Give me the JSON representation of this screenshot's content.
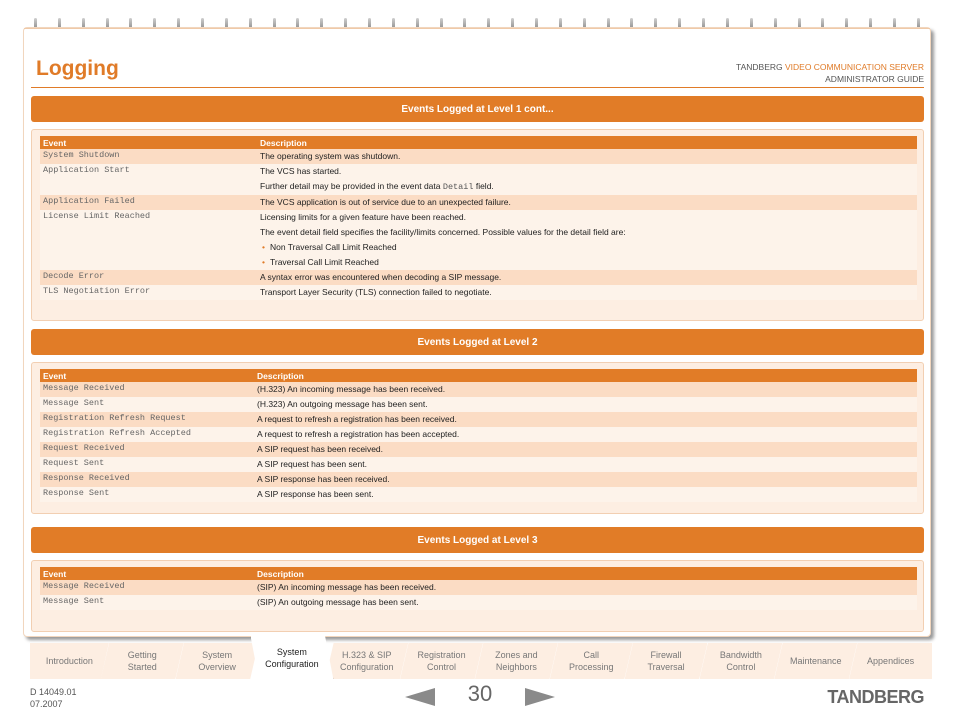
{
  "header": {
    "title": "Logging",
    "guide_prefix": "TANDBERG ",
    "guide_product": "VIDEO COMMUNICATION SERVER",
    "guide_type": "ADMINISTRATOR GUIDE"
  },
  "colors": {
    "accent": "#e17c27",
    "row_shade": "#fbdcc4",
    "box_bg": "#fdeee2"
  },
  "table_headers": {
    "event": "Event",
    "description": "Description"
  },
  "sections": [
    {
      "title": "Events Logged at Level 1 cont...",
      "rows": [
        {
          "event": "System Shutdown",
          "description": [
            "The operating system was shutdown."
          ]
        },
        {
          "event": "Application Start",
          "description": [
            "The VCS has started."
          ],
          "detail_pre": "Further detail may be provided in the event data ",
          "detail_code": "Detail",
          "detail_post": " field."
        },
        {
          "event": "Application Failed",
          "description": [
            "The VCS application is out of service due to an unexpected failure."
          ]
        },
        {
          "event": "License Limit Reached",
          "description": [
            "Licensing limits for a given feature have been reached.",
            "The event detail field specifies the facility/limits concerned. Possible values for the detail field are:"
          ],
          "bullets": [
            "Non Traversal Call Limit Reached",
            "Traversal Call Limit Reached"
          ]
        },
        {
          "event": "Decode Error",
          "description": [
            "A syntax error was encountered when decoding a SIP message."
          ]
        },
        {
          "event": "TLS Negotiation Error",
          "description": [
            "Transport Layer Security (TLS) connection failed to negotiate."
          ]
        }
      ]
    },
    {
      "title": "Events Logged at Level 2",
      "rows": [
        {
          "event": "Message Received",
          "description": [
            "(H.323) An incoming message has been received."
          ]
        },
        {
          "event": "Message Sent",
          "description": [
            "(H.323) An outgoing message has been sent."
          ]
        },
        {
          "event": "Registration Refresh Request",
          "description": [
            "A request to refresh a registration has been received."
          ]
        },
        {
          "event": "Registration Refresh Accepted",
          "description": [
            "A request to refresh a registration has been accepted."
          ]
        },
        {
          "event": "Request Received",
          "description": [
            "A SIP request has been received."
          ]
        },
        {
          "event": "Request Sent",
          "description": [
            "A SIP request has been sent."
          ]
        },
        {
          "event": "Response Received",
          "description": [
            "A SIP response has been received."
          ]
        },
        {
          "event": "Response Sent",
          "description": [
            "A SIP response has been sent."
          ]
        }
      ]
    },
    {
      "title": "Events Logged at Level 3",
      "rows": [
        {
          "event": "Message Received",
          "description": [
            "(SIP) An incoming message has been received."
          ]
        },
        {
          "event": "Message Sent",
          "description": [
            "(SIP) An outgoing message has been sent."
          ]
        }
      ]
    }
  ],
  "tabs": [
    {
      "line1": "Introduction",
      "line2": ""
    },
    {
      "line1": "Getting",
      "line2": "Started"
    },
    {
      "line1": "System",
      "line2": "Overview"
    },
    {
      "line1": "System",
      "line2": "Configuration",
      "active": true
    },
    {
      "line1": "H.323 & SIP",
      "line2": "Configuration"
    },
    {
      "line1": "Registration",
      "line2": "Control"
    },
    {
      "line1": "Zones and",
      "line2": "Neighbors"
    },
    {
      "line1": "Call",
      "line2": "Processing"
    },
    {
      "line1": "Firewall",
      "line2": "Traversal"
    },
    {
      "line1": "Bandwidth",
      "line2": "Control"
    },
    {
      "line1": "Maintenance",
      "line2": ""
    },
    {
      "line1": "Appendices",
      "line2": ""
    }
  ],
  "footer": {
    "doc_number": "D 14049.01",
    "date": "07.2007",
    "page_number": "30",
    "brand": "TANDBERG",
    "prev_icon": "prev-page-arrow",
    "next_icon": "next-page-arrow"
  }
}
